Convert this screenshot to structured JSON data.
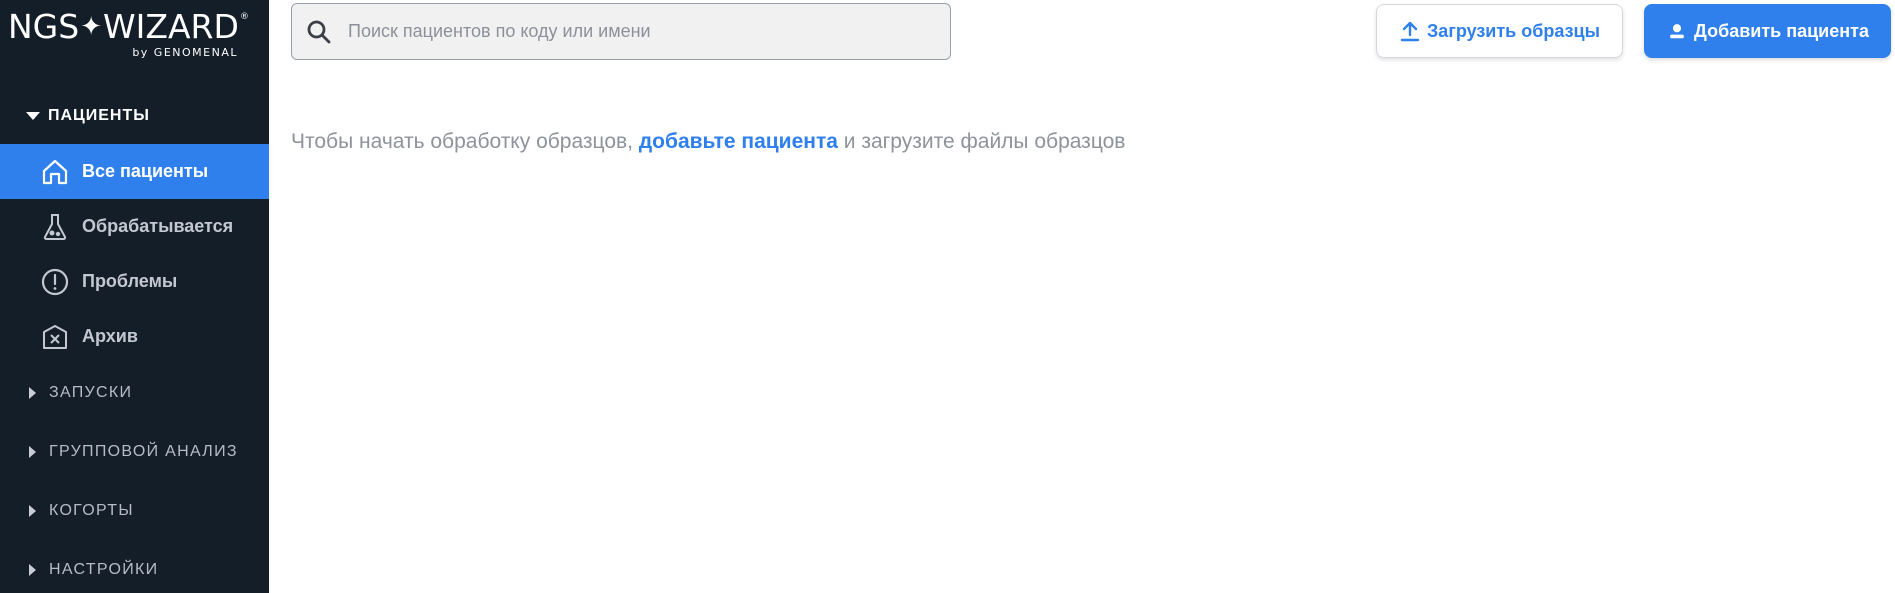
{
  "logo": {
    "main_left": "NGS",
    "star": "✦",
    "main_right": "WIZARD",
    "reg": "®",
    "sub": "by GENOMENAL"
  },
  "sidebar": {
    "patients_section": {
      "label": "ПАЦИЕНТЫ",
      "expanded": true
    },
    "items": [
      {
        "label": "Все пациенты",
        "icon": "home-icon",
        "active": true
      },
      {
        "label": "Обрабатывается",
        "icon": "flask-icon",
        "active": false
      },
      {
        "label": "Проблемы",
        "icon": "alert-icon",
        "active": false
      },
      {
        "label": "Архив",
        "icon": "archive-icon",
        "active": false
      }
    ],
    "sections": [
      {
        "label": "ЗАПУСКИ"
      },
      {
        "label": "ГРУППОВОЙ АНАЛИЗ"
      },
      {
        "label": "КОГОРТЫ"
      },
      {
        "label": "НАСТРОЙКИ"
      }
    ]
  },
  "search": {
    "placeholder": "Поиск пациентов по коду или имени",
    "value": ""
  },
  "toolbar": {
    "upload_label": "Загрузить образцы",
    "add_label": "Добавить пациента"
  },
  "empty_state": {
    "before": "Чтобы начать обработку образцов, ",
    "link": "добавьте пациента",
    "after": " и загрузите файлы образцов"
  },
  "colors": {
    "sidebar_bg": "#141e29",
    "accent": "#2f80ed"
  }
}
